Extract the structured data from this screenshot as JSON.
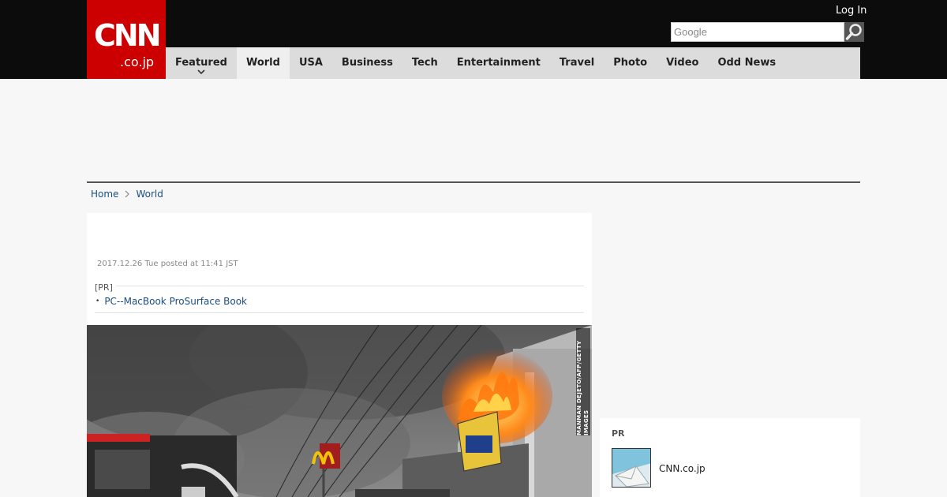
{
  "header": {
    "logo_main": "CNN",
    "logo_sub": ".co.jp",
    "login_label": "Log In",
    "search_placeholder": "Google"
  },
  "nav": {
    "items": [
      {
        "label": "Featured"
      },
      {
        "label": "World"
      },
      {
        "label": "USA"
      },
      {
        "label": "Business"
      },
      {
        "label": "Tech"
      },
      {
        "label": "Entertainment"
      },
      {
        "label": "Travel"
      },
      {
        "label": "Photo"
      },
      {
        "label": "Video"
      },
      {
        "label": "Odd News"
      }
    ],
    "active": "World"
  },
  "breadcrumb": {
    "home": "Home",
    "section": "World"
  },
  "article": {
    "date": "2017.12.26 Tue posted at 11:41 JST",
    "pr_label": "[PR]",
    "pr_link": "PC--MacBook ProSurface Book",
    "photo_credit": "MANMAN DEJETO/AFP/GETTY IMAGES"
  },
  "sidebar": {
    "pr_label": "PR",
    "pr_item_text": "CNN.co.jp"
  },
  "colors": {
    "brand": "#cc0000",
    "topbar": "#0c0c0c",
    "nav_bg": "#dcdcdc",
    "link": "#1a4d80"
  },
  "icons": [
    "search-icon",
    "chevron-down-icon",
    "chevron-right-icon",
    "envelope-icon"
  ]
}
